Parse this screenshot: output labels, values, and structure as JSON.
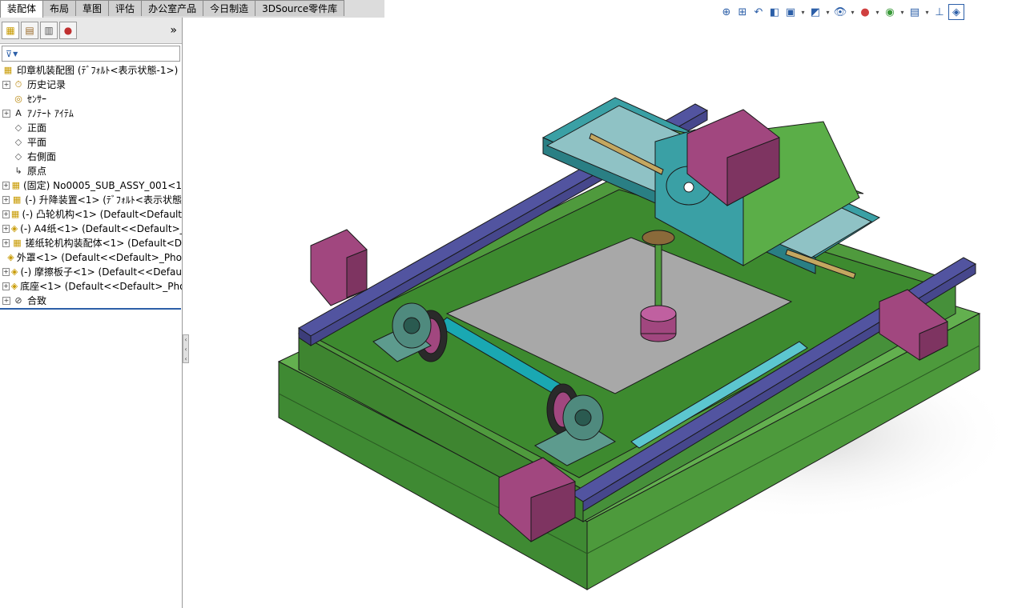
{
  "tabs": [
    "装配体",
    "布局",
    "草图",
    "评估",
    "办公室产品",
    "今日制造",
    "3DSource零件库"
  ],
  "active_tab": "装配体",
  "view_toolbar": [
    "zoom-to-fit-icon",
    "zoom-area-icon",
    "previous-view-icon",
    "section-view-icon",
    "view-orientation-icon",
    "display-style-icon",
    "hide-show-icon",
    "edit-appearance-icon",
    "apply-scene-icon",
    "view-settings-icon",
    "triad-icon",
    "isometric-cube-icon"
  ],
  "panel": {
    "tabs": [
      "feature-manager-icon",
      "property-manager-icon",
      "configuration-manager-icon",
      "display-manager-icon"
    ],
    "collapse": "»",
    "filter": "▼"
  },
  "tree": {
    "root": "印章机装配图 (ﾃﾞﾌｫﾙﾄ<表示状態-1>)",
    "items": [
      {
        "label": "历史记录",
        "icon": "history-icon",
        "expandable": true
      },
      {
        "label": "ｾﾝｻｰ",
        "icon": "sensor-icon",
        "expandable": false
      },
      {
        "label": "ｱﾉﾃｰﾄ ｱｲﾃﾑ",
        "icon": "annotation-icon",
        "expandable": true
      },
      {
        "label": "正面",
        "icon": "plane-icon",
        "expandable": false
      },
      {
        "label": "平面",
        "icon": "plane-icon",
        "expandable": false
      },
      {
        "label": "右側面",
        "icon": "plane-icon",
        "expandable": false
      },
      {
        "label": "原点",
        "icon": "origin-icon",
        "expandable": false
      },
      {
        "label": "(固定) No0005_SUB_ASSY_001<1",
        "icon": "assembly-icon",
        "expandable": true
      },
      {
        "label": "(-) 升降装置<1> (ﾃﾞﾌｫﾙﾄ<表示状態",
        "icon": "assembly-icon",
        "expandable": true
      },
      {
        "label": "(-) 凸轮机构<1> (Default<Default",
        "icon": "assembly-icon",
        "expandable": true
      },
      {
        "label": "(-) A4纸<1> (Default<<Default>_",
        "icon": "part-icon",
        "expandable": true
      },
      {
        "label": "搓纸轮机构装配体<1> (Default<D",
        "icon": "assembly-icon",
        "expandable": true
      },
      {
        "label": "外罩<1> (Default<<Default>_Pho",
        "icon": "part-icon",
        "expandable": false
      },
      {
        "label": "(-) 摩擦板子<1> (Default<<Defau",
        "icon": "part-icon",
        "expandable": true
      },
      {
        "label": "底座<1> (Default<<Default>_Pho",
        "icon": "part-icon",
        "expandable": true
      },
      {
        "label": "合致",
        "icon": "mates-icon",
        "expandable": true
      }
    ]
  },
  "colors": {
    "base_green": "#4f9a3d",
    "rail_blue": "#5254a0",
    "motor_magenta": "#a1477f",
    "teal": "#3aa0a5",
    "paper_gray": "#a8a8a8"
  }
}
